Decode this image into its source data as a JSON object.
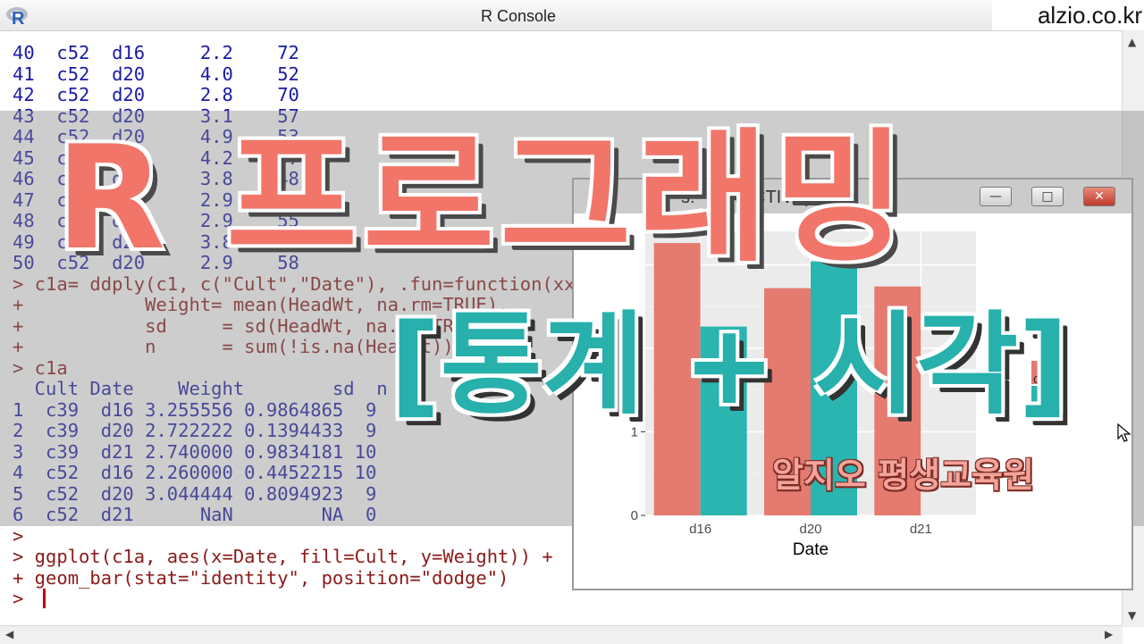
{
  "window": {
    "title": "R Console",
    "watermark": "alzio.co.kr"
  },
  "console": {
    "data_rows": [
      "40  c52  d16     2.2    72",
      "41  c52  d20     4.0    52",
      "42  c52  d20     2.8    70",
      "43  c52  d20     3.1    57",
      "44  c52  d20     4.9    53",
      "45  c52  d20     4.2    47",
      "46  c52  d20     3.8    48",
      "47  c52  d20     2.9    57",
      "48  c52  d20     2.9    55",
      "49  c52  d20     3.8    54",
      "50  c52  d20     2.9    58"
    ],
    "ddply_cmd": [
      "> c1a= ddply(c1, c(\"Cult\",\"Date\"), .fun=function(xx){",
      "+           Weight= mean(HeadWt, na.rm=TRUE),",
      "+           sd     = sd(HeadWt, na.rm=TRUE),",
      "+           n      = sum(!is.na(HeadWt))"
    ],
    "print_cmd": "> c1a",
    "table_header": "  Cult Date    Weight        sd  n",
    "table_rows": [
      "1  c39  d16 3.255556 0.9864865  9",
      "2  c39  d20 2.722222 0.1394433  9",
      "3  c39  d21 2.740000 0.9834181 10",
      "4  c52  d16 2.260000 0.4452215 10",
      "5  c52  d20 3.044444 0.8094923  9",
      "6  c52  d21      NaN        NA  0"
    ],
    "blank_prompt": ">",
    "ggplot_cmd": "> ggplot(c1a, aes(x=Date, fill=Cult, y=Weight)) +",
    "geom_cmd": "+ geom_bar(stat=\"identity\", position=\"dodge\")",
    "active_prompt": ">"
  },
  "graphics_window": {
    "title": "R Graphics: Device 2 (ACTIVE)",
    "visible_title": "s:     2 (ACTIVE)",
    "minimize_symbol": "—",
    "maximize_symbol": "□",
    "close_symbol": "✕"
  },
  "chart_data": {
    "type": "bar",
    "categories": [
      "d16",
      "d20",
      "d21"
    ],
    "series": [
      {
        "name": "c39",
        "values": [
          3.26,
          2.72,
          2.74
        ],
        "color": "#e57a70"
      },
      {
        "name": "c52",
        "values": [
          2.26,
          3.04,
          null
        ],
        "color": "#2ab5b0"
      }
    ],
    "xlabel": "Date",
    "ylabel": "",
    "yticks": [
      0,
      1
    ],
    "ylim": [
      0,
      3.4
    ],
    "grid": true,
    "legend_position": "right",
    "legend_visible_text": "c3"
  },
  "overlay": {
    "headline": "R 프로그래밍",
    "subhead": "[통계 + 시각]",
    "brand": "알지오 평생교육원",
    "colors": {
      "headline": "#f2756a",
      "subhead": "#27b0ac",
      "brand": "#f4a39a"
    }
  }
}
